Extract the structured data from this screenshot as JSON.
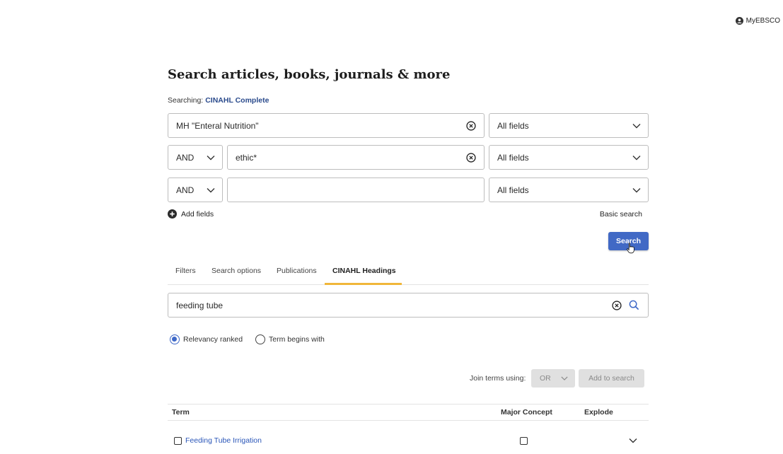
{
  "header": {
    "user_label": "MyEBSCO"
  },
  "page": {
    "title": "Search articles, books, journals & more",
    "searching_label": "Searching:",
    "database": "CINAHL Complete"
  },
  "search_rows": [
    {
      "term": "MH \"Enteral Nutrition\"",
      "field": "All fields"
    },
    {
      "operator": "AND",
      "term": "ethic*",
      "field": "All fields"
    },
    {
      "operator": "AND",
      "term": "",
      "field": "All fields"
    }
  ],
  "actions": {
    "add_fields": "Add fields",
    "basic_search": "Basic search",
    "search": "Search"
  },
  "tabs": [
    {
      "label": "Filters",
      "active": false
    },
    {
      "label": "Search options",
      "active": false
    },
    {
      "label": "Publications",
      "active": false
    },
    {
      "label": "CINAHL Headings",
      "active": true
    }
  ],
  "headings": {
    "query": "feeding tube",
    "radio_options": [
      {
        "label": "Relevancy ranked",
        "selected": true
      },
      {
        "label": "Term begins with",
        "selected": false
      }
    ],
    "join_label": "Join terms using:",
    "join_value": "OR",
    "add_to_search": "Add to search",
    "columns": [
      "Term",
      "Major Concept",
      "Explode"
    ],
    "rows": [
      {
        "term": "Feeding Tube Irrigation"
      }
    ]
  },
  "colors": {
    "accent": "#4169c5",
    "tab_underline": "#f0b63a",
    "link": "#2a56b8"
  }
}
